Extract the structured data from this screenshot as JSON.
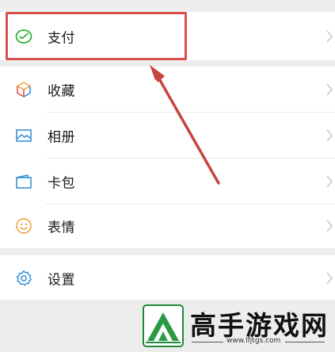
{
  "menu": {
    "payment": {
      "label": "支付",
      "icon": "payment-icon"
    },
    "items": [
      {
        "label": "收藏",
        "icon": "favorites-cube-icon"
      },
      {
        "label": "相册",
        "icon": "album-image-icon"
      },
      {
        "label": "卡包",
        "icon": "card-wallet-icon"
      },
      {
        "label": "表情",
        "icon": "smiley-face-icon"
      }
    ],
    "settings": {
      "label": "设置",
      "icon": "settings-gear-icon"
    }
  },
  "watermark": {
    "text": "高手游戏网",
    "url": "www.lfjtgs.com"
  },
  "colors": {
    "accent_green": "#1aad19",
    "icon_blue": "#2a8ad6",
    "icon_orange": "#f0a030",
    "highlight_red": "#d9504e",
    "background": "#ededed"
  }
}
